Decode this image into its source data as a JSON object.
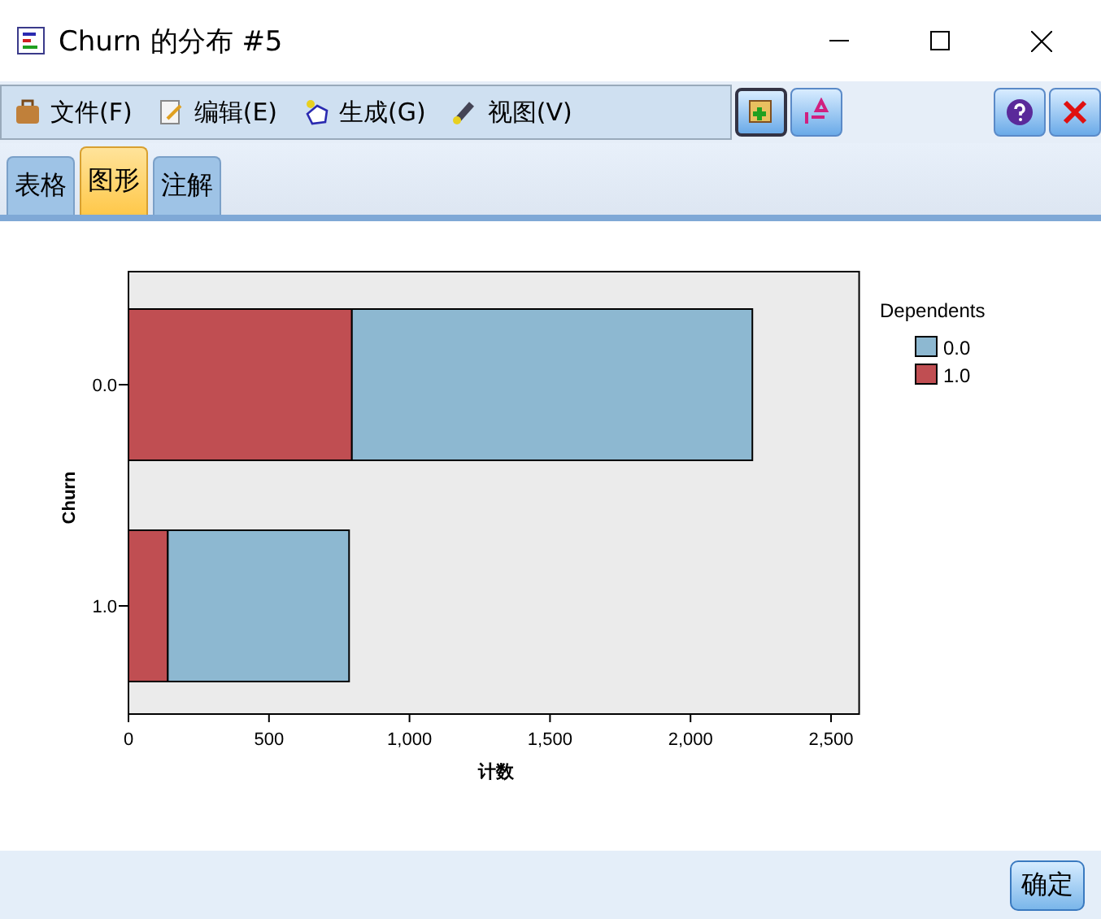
{
  "window": {
    "title": "Churn 的分布 #5"
  },
  "menu": [
    {
      "label": "文件(F)",
      "kind": "file"
    },
    {
      "label": "编辑(E)",
      "kind": "edit"
    },
    {
      "label": "生成(G)",
      "kind": "generate"
    },
    {
      "label": "视图(V)",
      "kind": "view"
    }
  ],
  "tabs": [
    {
      "label": "表格",
      "selected": false
    },
    {
      "label": "图形",
      "selected": true
    },
    {
      "label": "注解",
      "selected": false
    }
  ],
  "chart_data": {
    "type": "bar",
    "orientation": "horizontal",
    "stacked": true,
    "xlabel": "计数",
    "ylabel": "Churn",
    "categories": [
      "0.0",
      "1.0"
    ],
    "legend": {
      "title": "Dependents"
    },
    "series": [
      {
        "name": "0.0",
        "color": "#8db8d1",
        "values": [
          1425,
          645
        ]
      },
      {
        "name": "1.0",
        "color": "#c04e52",
        "values": [
          795,
          140
        ]
      }
    ],
    "xlim": [
      0,
      2600
    ],
    "xticks": [
      {
        "value": 0,
        "label": "0"
      },
      {
        "value": 500,
        "label": "500"
      },
      {
        "value": 1000,
        "label": "1,000"
      },
      {
        "value": 1500,
        "label": "1,500"
      },
      {
        "value": 2000,
        "label": "2,000"
      },
      {
        "value": 2500,
        "label": "2,500"
      }
    ]
  },
  "buttons": [
    {
      "label": "确定"
    }
  ]
}
